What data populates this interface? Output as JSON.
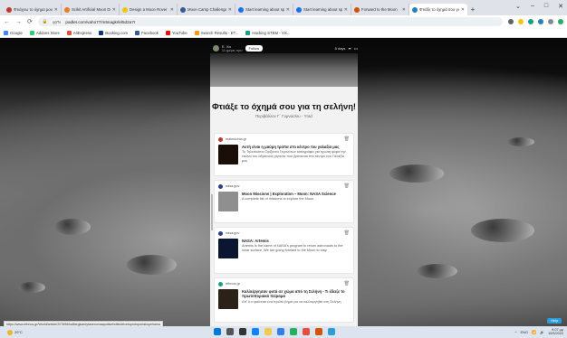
{
  "browser": {
    "tabs": [
      {
        "label": "Φτιάχνω το όχημα μου για τη",
        "color": "#c0392b"
      },
      {
        "label": "Scikit Artificial Moon Drive",
        "color": "#e67e22"
      },
      {
        "label": "Design a Moon Rover in 1",
        "color": "#f1c40f"
      },
      {
        "label": "Moon Camp Challenge",
        "color": "#3b5998"
      },
      {
        "label": "Start learning about space",
        "color": "#1f6feb"
      },
      {
        "label": "Start learning about space",
        "color": "#1f6feb"
      },
      {
        "label": "Forward to the Moon",
        "color": "#d35400"
      },
      {
        "label": "Φτιάξε το όχημά σου για",
        "color": "#2980b9",
        "active": true
      }
    ],
    "new_tab": "+",
    "window_controls": [
      "⌄",
      "–",
      "□",
      "✕"
    ],
    "nav": {
      "back": "←",
      "forward": "→",
      "reload": "⟳"
    },
    "url_site": "ηηΠε",
    "url": "padlet.com/vaho77/m5nagkrlel5d2a7r",
    "bookmarks": [
      {
        "label": "Google",
        "color": "#4285f4"
      },
      {
        "label": "Addons Store",
        "color": "#2ecc71"
      },
      {
        "label": "AliExpress",
        "color": "#e74c3c"
      },
      {
        "label": "Booking.com",
        "color": "#003580"
      },
      {
        "label": "Facebook",
        "color": "#3b5998"
      },
      {
        "label": "YouTube",
        "color": "#ff0000"
      },
      {
        "label": "Search Results - ET...",
        "color": "#f39c12"
      },
      {
        "label": "Hacking STEM - Vis...",
        "color": "#16a085"
      }
    ]
  },
  "padlet": {
    "author_name": "Ε. Χα",
    "author_meta": "11 ημέρες πριν",
    "follow_label": "Follow",
    "time_ago": "8 days",
    "title": "Φτιάξε το όχημά σου για τη σελήνη!",
    "subtitle": "Περιβάλλον Γ΄ Γυμνασίου - Yrad",
    "cards": [
      {
        "source": "makedonia.gr",
        "dot": "#c0392b",
        "thumb": "#1a0f08",
        "title": "Αυτή είναι η μαύρη τρύπα στο κέντρο του γαλαξία μας",
        "desc": "Το Τηλεσκόπιο Ορίζοντα Γεγονότων καταγράφει για πρώτη φορά την εικόνα του αδρανούς γίγαντα που βρίσκεται στο κέντρο του Γαλαξία μας"
      },
      {
        "source": "nasa.gov",
        "dot": "#2c3e8f",
        "thumb": "#8f8f8f",
        "title": "Moon Missions | Exploration – Moon: NASA Science",
        "desc": "A complete list of missions to explore the Moon."
      },
      {
        "source": "nasa.gov",
        "dot": "#2c3e8f",
        "thumb": "#0b1730",
        "title": "NASA: Artemis",
        "desc": "Artemis is the name of NASA's program to return astronauts to the lunar surface. We are going forward to the Moon to stay."
      },
      {
        "source": "ethnos.gr",
        "dot": "#16a085",
        "thumb": "#2a2118",
        "title": "Καλλιέργησαν φυτά σε χώμα από τη Σελήνη - Τι έδειξε το πρωτοποριακό πείραμα",
        "desc": "Απ' ό,τι φαίνεται ένα πρώτο βήμα για να καλλιεργηθεί στη Σελήνη"
      }
    ]
  },
  "status_url": "https://www.ethnos.gr/World/article/207896/kalliergisanfytasexomaapotiselinitiedeixetoprotoporiakopeirama",
  "help_label": "Help",
  "taskbar": {
    "weather": "29°C",
    "tray_icons": [
      "^",
      "ENG",
      "📶",
      "🔊"
    ],
    "time": "9:07 μμ",
    "date": "15/5/2022"
  }
}
